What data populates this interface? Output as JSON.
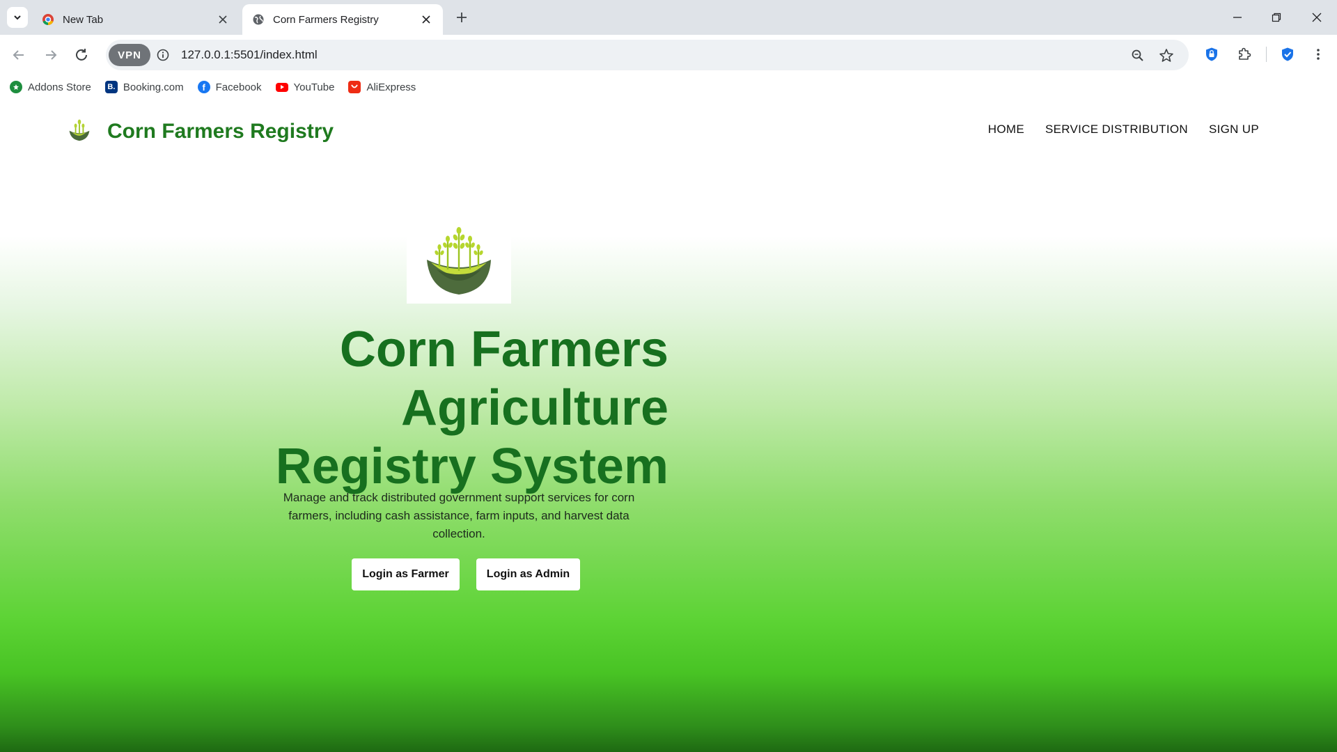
{
  "browser": {
    "tabs": [
      {
        "title": "New Tab",
        "active": false
      },
      {
        "title": "Corn Farmers Registry",
        "active": true
      }
    ],
    "vpn_label": "VPN",
    "url": "127.0.0.1:5501/index.html",
    "bookmarks": [
      {
        "label": "Addons Store",
        "icon": "addons-icon",
        "color": "#1e8e3e"
      },
      {
        "label": "Booking.com",
        "icon": "booking-icon",
        "color": "#003580"
      },
      {
        "label": "Facebook",
        "icon": "facebook-icon",
        "color": "#1877f2"
      },
      {
        "label": "YouTube",
        "icon": "youtube-icon",
        "color": "#ff0000"
      },
      {
        "label": "AliExpress",
        "icon": "aliexpress-icon",
        "color": "#ee2c14"
      }
    ]
  },
  "site": {
    "brand": "Corn Farmers Registry",
    "menu": [
      "HOME",
      "SERVICE DISTRIBUTION",
      "SIGN UP"
    ],
    "hero": {
      "title_lines": [
        "Corn Farmers",
        "Agriculture",
        "Registry System"
      ],
      "description": "Manage and track distributed government support services for corn farmers, including cash assistance, farm inputs, and harvest data collection.",
      "buttons": {
        "farmer": "Login as Farmer",
        "admin": "Login as Admin"
      }
    },
    "colors": {
      "brand_green": "#1f7a1f",
      "title_green": "#17701f"
    }
  }
}
